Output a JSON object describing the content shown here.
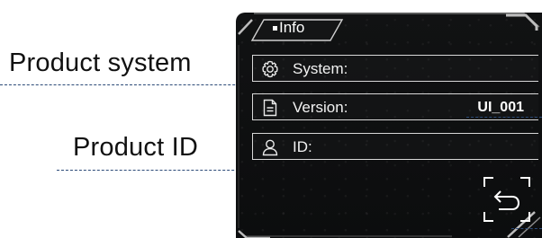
{
  "callouts": {
    "product_system": "Product system",
    "product_id": "Product ID"
  },
  "device": {
    "tab_title": "Info",
    "rows": [
      {
        "icon": "gear-icon",
        "label": "System:",
        "value": ""
      },
      {
        "icon": "document-icon",
        "label": "Version:",
        "value": "UI_001"
      },
      {
        "icon": "user-icon",
        "label": "ID:",
        "value": ""
      }
    ],
    "back_icon": "return-arrow-icon"
  },
  "colors": {
    "screen_bg": "#0f1011",
    "frame": "#9a9a9a",
    "text": "#ffffff",
    "dash": "#2b4a78"
  }
}
